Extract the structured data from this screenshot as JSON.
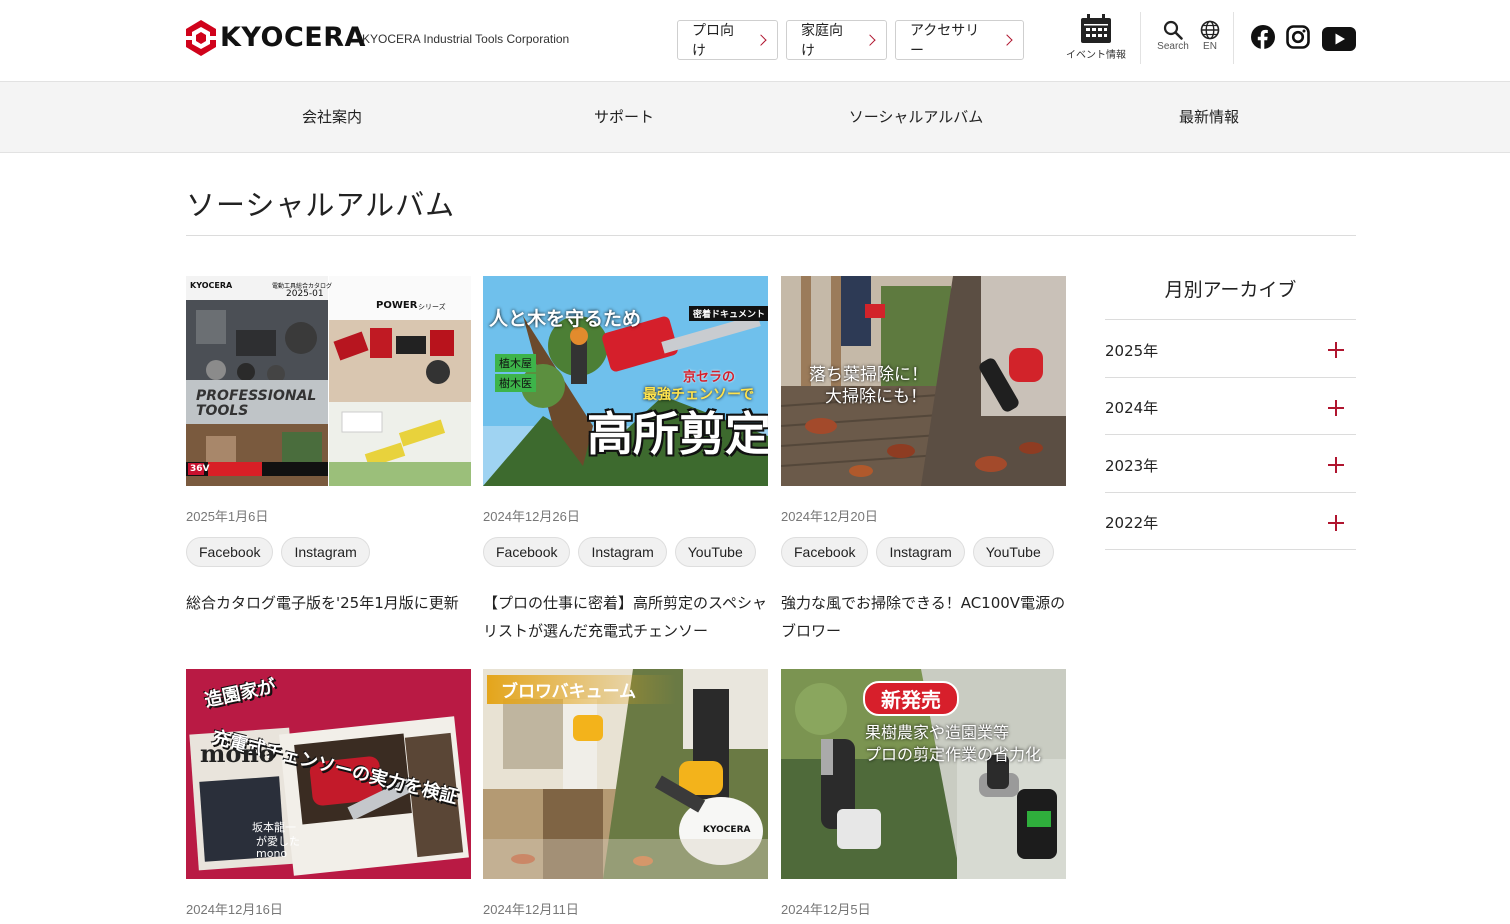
{
  "header": {
    "brand": "KYOCERA",
    "corp_name": "KYOCERA Industrial Tools Corporation",
    "buttons": [
      "プロ向け",
      "家庭向け",
      "アクセサリー"
    ],
    "event_label": "イベント情報",
    "search_label": "Search",
    "lang_label": "EN",
    "accent_color": "#b0152f"
  },
  "nav": {
    "items": [
      "会社案内",
      "サポート",
      "ソーシャルアルバム",
      "最新情報"
    ]
  },
  "page": {
    "title": "ソーシャルアルバム"
  },
  "cards": [
    {
      "date": "2025年1月6日",
      "tags": [
        "Facebook",
        "Instagram"
      ],
      "title": "総合カタログ電子版を'25年1月版に更新",
      "thumb": {
        "lines": [
          "KYOCERA",
          "電動工具総合カタログ",
          "2025-01",
          "PROFESSIONAL",
          "TOOLS",
          "POWER",
          "シリーズ",
          "36V"
        ]
      }
    },
    {
      "date": "2024年12月26日",
      "tags": [
        "Facebook",
        "Instagram",
        "YouTube"
      ],
      "title": "【プロの仕事に密着】高所剪定のスペシャリストが選んだ充電式チェンソー",
      "thumb": {
        "lines": [
          "人と木を守るため",
          "密着ドキュメント",
          "植木屋",
          "樹木医",
          "京セラの",
          "最強チェンソーで",
          "高所剪定"
        ]
      }
    },
    {
      "date": "2024年12月20日",
      "tags": [
        "Facebook",
        "Instagram",
        "YouTube"
      ],
      "title": "強力な風でお掃除できる！AC100V電源のブロワー",
      "thumb": {
        "lines": [
          "落ち葉掃除に！",
          "大掃除にも！"
        ]
      }
    },
    {
      "date": "2024年12月16日",
      "tags": [],
      "title": "",
      "thumb": {
        "lines": [
          "造園家が",
          "充電式チェンソーの実力を検証",
          "mono",
          "坂本龍一",
          "が愛した",
          "mono"
        ]
      }
    },
    {
      "date": "2024年12月11日",
      "tags": [],
      "title": "",
      "thumb": {
        "lines": [
          "ブロワバキューム",
          "KYOCERA"
        ]
      }
    },
    {
      "date": "2024年12月5日",
      "tags": [],
      "title": "",
      "thumb": {
        "lines": [
          "新発売",
          "果樹農家や造園業等",
          "プロの剪定作業の省力化"
        ]
      }
    }
  ],
  "archive": {
    "title": "月別アーカイブ",
    "years": [
      "2025年",
      "2024年",
      "2023年",
      "2022年"
    ]
  }
}
